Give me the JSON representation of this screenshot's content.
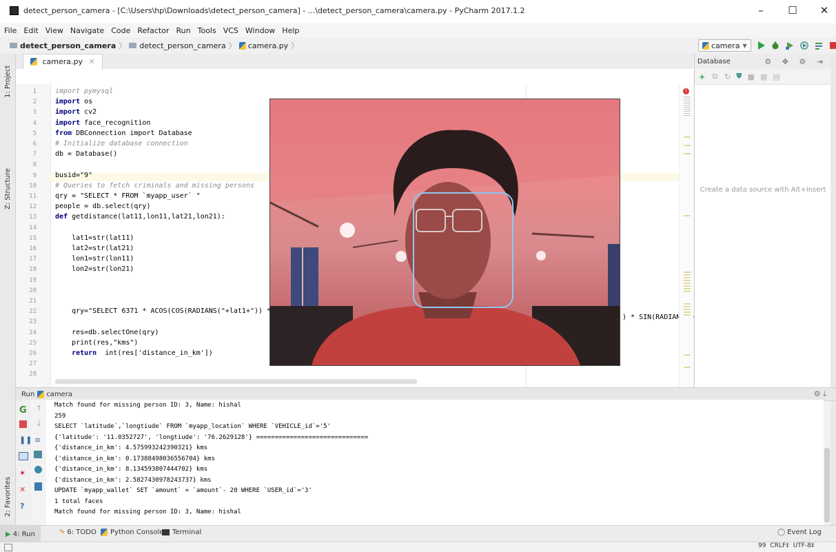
{
  "window": {
    "title": "detect_person_camera - [C:\\Users\\hp\\Downloads\\detect_person_camera] - ...\\detect_person_camera\\camera.py - PyCharm 2017.1.2",
    "minimize": "–",
    "maximize": "☐",
    "close": "✕"
  },
  "menu": [
    "File",
    "Edit",
    "View",
    "Navigate",
    "Code",
    "Refactor",
    "Run",
    "Tools",
    "VCS",
    "Window",
    "Help"
  ],
  "breadcrumb": {
    "project": "detect_person_camera",
    "folder": "detect_person_camera",
    "file": "camera.py"
  },
  "run_config": {
    "name": "camera",
    "colors": {
      "run": "#2ea043",
      "debug": "#3c8a2e",
      "stop": "#d93737"
    }
  },
  "side_tabs": {
    "project": "1: Project",
    "structure": "Z: Structure",
    "favorites": "2: Favorites"
  },
  "editor": {
    "tab_label": "camera.py",
    "line_numbers": [
      "1",
      "2",
      "3",
      "4",
      "5",
      "6",
      "7",
      "8",
      "9",
      "10",
      "11",
      "12",
      "13",
      "14",
      "15",
      "16",
      "17",
      "18",
      "19",
      "20",
      "21",
      "22",
      "23",
      "24",
      "25",
      "26",
      "27",
      "28"
    ],
    "lines": [
      {
        "t": "cm",
        "text": "import pymysql"
      },
      {
        "t": "mix",
        "kw": "import",
        "rest": " os"
      },
      {
        "t": "mix",
        "kw": "import",
        "rest": " cv2"
      },
      {
        "t": "mix",
        "kw": "import",
        "rest": " face_recognition"
      },
      {
        "t": "mix",
        "kw": "from",
        "rest": " DBConnection import Database"
      },
      {
        "t": "cm",
        "text": "# Initialize database connection"
      },
      {
        "t": "plain",
        "text": "db = Database()"
      },
      {
        "t": "plain",
        "text": ""
      },
      {
        "t": "plain",
        "text": "busid=\"9\""
      },
      {
        "t": "cm",
        "text": "# Queries to fetch criminals and missing persons"
      },
      {
        "t": "plain",
        "text": "qry = \"SELECT * FROM `myapp_user` \""
      },
      {
        "t": "plain",
        "text": "people = db.select(qry)"
      },
      {
        "t": "mix",
        "kw": "def",
        "rest": " getdistance(lat11,lon11,lat21,lon21):"
      },
      {
        "t": "plain",
        "text": ""
      },
      {
        "t": "plain",
        "text": "    lat1=str(lat11)"
      },
      {
        "t": "plain",
        "text": "    lat2=str(lat21)"
      },
      {
        "t": "plain",
        "text": "    lon1=str(lon11)"
      },
      {
        "t": "plain",
        "text": "    lon2=str(lon21)"
      },
      {
        "t": "plain",
        "text": ""
      },
      {
        "t": "plain",
        "text": ""
      },
      {
        "t": "plain",
        "text": ""
      },
      {
        "t": "plain",
        "text": "    qry=\"SELECT 6371 * ACOS(COS(RADIANS(\"+lat1+\")) * CO"
      },
      {
        "t": "plain",
        "text": ""
      },
      {
        "t": "plain",
        "text": "    res=db.selectOne(qry)"
      },
      {
        "t": "plain",
        "text": "    print(res,\"kms\")"
      },
      {
        "t": "mix",
        "kw": "    return",
        "rest": "  int(res['distance_in_km'])"
      },
      {
        "t": "plain",
        "text": ""
      },
      {
        "t": "plain",
        "text": ""
      }
    ],
    "overflow_text": ") * SIN(RADIANS(\"+"
  },
  "database_panel": {
    "title": "Database",
    "empty_text": "Create a data source with Alt+Insert"
  },
  "run_panel": {
    "title": "Run",
    "config": "camera",
    "output": [
      "Match found for missing person ID: 3, Name: hishal",
      "259",
      "SELECT `latitude`,`longtiude` FROM `myapp_location` WHERE `VEHICLE_id`='5'",
      "{'latitude': '11.0352727', 'longtiude': '76.2629128'} ==============================",
      "{'distance_in_km': 4.575993242390321} kms",
      "{'distance_in_km': 0.17388498036556704} kms",
      "{'distance_in_km': 8.134593807444702} kms",
      "{'distance_in_km': 2.5827430978243737} kms",
      "UPDATE `myapp_wallet` SET `amount` = `amount`- 20 WHERE `USER_id`='3'",
      "1 total faces",
      "Match found for missing person ID: 3, Name: hishal"
    ]
  },
  "bottom_tabs": [
    "4: Run",
    "6: TODO",
    "Python Console",
    "Terminal"
  ],
  "event_log": "Event Log",
  "status": {
    "position": "99",
    "line_sep": "CRLF‡",
    "encoding": "UTF-8‡"
  }
}
